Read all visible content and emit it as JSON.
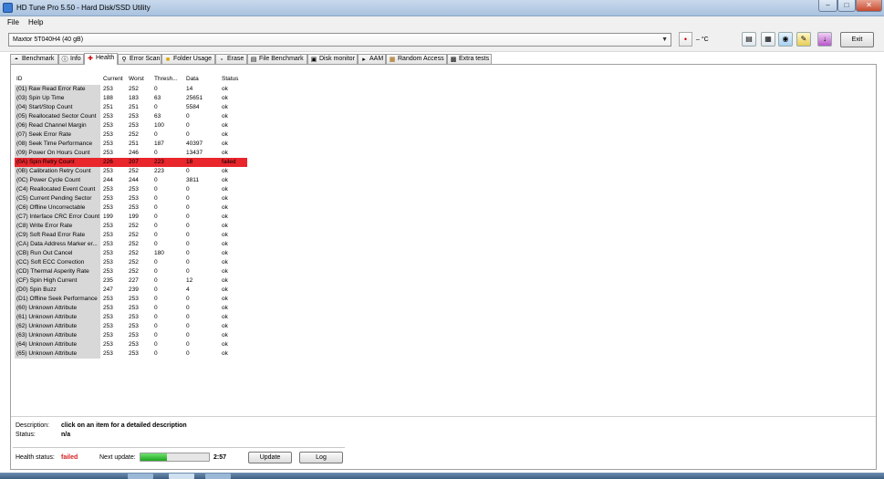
{
  "window": {
    "title": "HD Tune Pro 5.50 - Hard Disk/SSD Utility"
  },
  "menu": {
    "file": "File",
    "help": "Help"
  },
  "toolbar": {
    "drive": "Maxtor 5T040H4 (40 gB)",
    "temperature": "– °C",
    "exit_label": "Exit"
  },
  "tabs": [
    {
      "label": "Benchmark",
      "icon": "benchmark-icon"
    },
    {
      "label": "Info",
      "icon": "info-icon"
    },
    {
      "label": "Health",
      "icon": "health-icon"
    },
    {
      "label": "Error Scan",
      "icon": "error-scan-icon"
    },
    {
      "label": "Folder Usage",
      "icon": "folder-icon"
    },
    {
      "label": "Erase",
      "icon": "erase-icon"
    },
    {
      "label": "File Benchmark",
      "icon": "file-benchmark-icon"
    },
    {
      "label": "Disk monitor",
      "icon": "disk-monitor-icon"
    },
    {
      "label": "AAM",
      "icon": "speaker-icon"
    },
    {
      "label": "Random Access",
      "icon": "random-access-icon"
    },
    {
      "label": "Extra tests",
      "icon": "extra-tests-icon"
    }
  ],
  "columns": {
    "id": "ID",
    "current": "Current",
    "worst": "Worst",
    "threshold": "Thresh...",
    "data": "Data",
    "status": "Status"
  },
  "rows": [
    {
      "id": "(01) Raw Read Error Rate",
      "current": "253",
      "worst": "252",
      "threshold": "0",
      "data": "14",
      "status": "ok"
    },
    {
      "id": "(03) Spin Up Time",
      "current": "188",
      "worst": "183",
      "threshold": "63",
      "data": "25651",
      "status": "ok"
    },
    {
      "id": "(04) Start/Stop Count",
      "current": "251",
      "worst": "251",
      "threshold": "0",
      "data": "5584",
      "status": "ok"
    },
    {
      "id": "(05) Reallocated Sector Count",
      "current": "253",
      "worst": "253",
      "threshold": "63",
      "data": "0",
      "status": "ok"
    },
    {
      "id": "(06) Read Channel Margin",
      "current": "253",
      "worst": "253",
      "threshold": "100",
      "data": "0",
      "status": "ok"
    },
    {
      "id": "(07) Seek Error Rate",
      "current": "253",
      "worst": "252",
      "threshold": "0",
      "data": "0",
      "status": "ok"
    },
    {
      "id": "(08) Seek Time Performance",
      "current": "253",
      "worst": "251",
      "threshold": "187",
      "data": "40397",
      "status": "ok"
    },
    {
      "id": "(09) Power On Hours Count",
      "current": "253",
      "worst": "246",
      "threshold": "0",
      "data": "13437",
      "status": "ok"
    },
    {
      "id": "(0A) Spin Retry Count",
      "current": "226",
      "worst": "207",
      "threshold": "223",
      "data": "18",
      "status": "failed"
    },
    {
      "id": "(0B) Calibration Retry Count",
      "current": "253",
      "worst": "252",
      "threshold": "223",
      "data": "0",
      "status": "ok"
    },
    {
      "id": "(0C) Power Cycle Count",
      "current": "244",
      "worst": "244",
      "threshold": "0",
      "data": "3811",
      "status": "ok"
    },
    {
      "id": "(C4) Reallocated Event Count",
      "current": "253",
      "worst": "253",
      "threshold": "0",
      "data": "0",
      "status": "ok"
    },
    {
      "id": "(C5) Current Pending Sector",
      "current": "253",
      "worst": "253",
      "threshold": "0",
      "data": "0",
      "status": "ok"
    },
    {
      "id": "(C6) Offline Uncorrectable",
      "current": "253",
      "worst": "253",
      "threshold": "0",
      "data": "0",
      "status": "ok"
    },
    {
      "id": "(C7) Interface CRC Error Count",
      "current": "199",
      "worst": "199",
      "threshold": "0",
      "data": "0",
      "status": "ok"
    },
    {
      "id": "(C8) Write Error Rate",
      "current": "253",
      "worst": "252",
      "threshold": "0",
      "data": "0",
      "status": "ok"
    },
    {
      "id": "(C9) Soft Read Error Rate",
      "current": "253",
      "worst": "252",
      "threshold": "0",
      "data": "0",
      "status": "ok"
    },
    {
      "id": "(CA) Data Address Marker er...",
      "current": "253",
      "worst": "252",
      "threshold": "0",
      "data": "0",
      "status": "ok"
    },
    {
      "id": "(CB) Run Out Cancel",
      "current": "253",
      "worst": "252",
      "threshold": "180",
      "data": "0",
      "status": "ok"
    },
    {
      "id": "(CC) Soft ECC Correction",
      "current": "253",
      "worst": "252",
      "threshold": "0",
      "data": "0",
      "status": "ok"
    },
    {
      "id": "(CD) Thermal Asperity Rate",
      "current": "253",
      "worst": "252",
      "threshold": "0",
      "data": "0",
      "status": "ok"
    },
    {
      "id": "(CF) Spin High Current",
      "current": "235",
      "worst": "227",
      "threshold": "0",
      "data": "12",
      "status": "ok"
    },
    {
      "id": "(D0) Spin Buzz",
      "current": "247",
      "worst": "239",
      "threshold": "0",
      "data": "4",
      "status": "ok"
    },
    {
      "id": "(D1) Offline Seek Performance",
      "current": "253",
      "worst": "253",
      "threshold": "0",
      "data": "0",
      "status": "ok"
    },
    {
      "id": "(60) Unknown Attribute",
      "current": "253",
      "worst": "253",
      "threshold": "0",
      "data": "0",
      "status": "ok"
    },
    {
      "id": "(61) Unknown Attribute",
      "current": "253",
      "worst": "253",
      "threshold": "0",
      "data": "0",
      "status": "ok"
    },
    {
      "id": "(62) Unknown Attribute",
      "current": "253",
      "worst": "253",
      "threshold": "0",
      "data": "0",
      "status": "ok"
    },
    {
      "id": "(63) Unknown Attribute",
      "current": "253",
      "worst": "253",
      "threshold": "0",
      "data": "0",
      "status": "ok"
    },
    {
      "id": "(64) Unknown Attribute",
      "current": "253",
      "worst": "253",
      "threshold": "0",
      "data": "0",
      "status": "ok"
    },
    {
      "id": "(65) Unknown Attribute",
      "current": "253",
      "worst": "253",
      "threshold": "0",
      "data": "0",
      "status": "ok"
    }
  ],
  "details": {
    "description_label": "Description:",
    "description_value": "click on an item for a detailed description",
    "status_label": "Status:",
    "status_value": "n/a"
  },
  "health": {
    "label": "Health status:",
    "value": "failed",
    "next_update_label": "Next update:",
    "progress": 0.38,
    "time": "2:57",
    "update_label": "Update",
    "log_label": "Log"
  },
  "colors": {
    "failed_row": "#e8262c",
    "failed_text": "#d42020",
    "progress": "#1fa51f"
  }
}
